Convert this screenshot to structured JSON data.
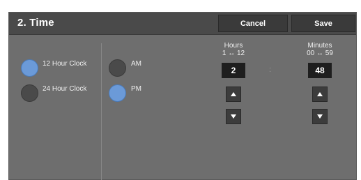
{
  "header": {
    "title": "2. Time",
    "cancel_label": "Cancel",
    "save_label": "Save"
  },
  "clock_format": {
    "options": [
      {
        "label": "12 Hour Clock",
        "selected": true
      },
      {
        "label": "24 Hour Clock",
        "selected": false
      }
    ]
  },
  "meridiem": {
    "options": [
      {
        "label": "AM",
        "selected": false
      },
      {
        "label": "PM",
        "selected": true
      }
    ]
  },
  "hours": {
    "label": "Hours",
    "range": "1 ↔ 12",
    "value": "2",
    "up_icon": "triangle-up-icon",
    "down_icon": "triangle-down-icon"
  },
  "separator": ":",
  "minutes": {
    "label": "Minutes",
    "range": "00 ↔ 59",
    "value": "48",
    "up_icon": "triangle-up-icon",
    "down_icon": "triangle-down-icon"
  },
  "colors": {
    "selected": "#6b9ad8",
    "unselected": "#4a4a4a",
    "panel": "#6e6e6e",
    "header": "#4a4a4a"
  }
}
